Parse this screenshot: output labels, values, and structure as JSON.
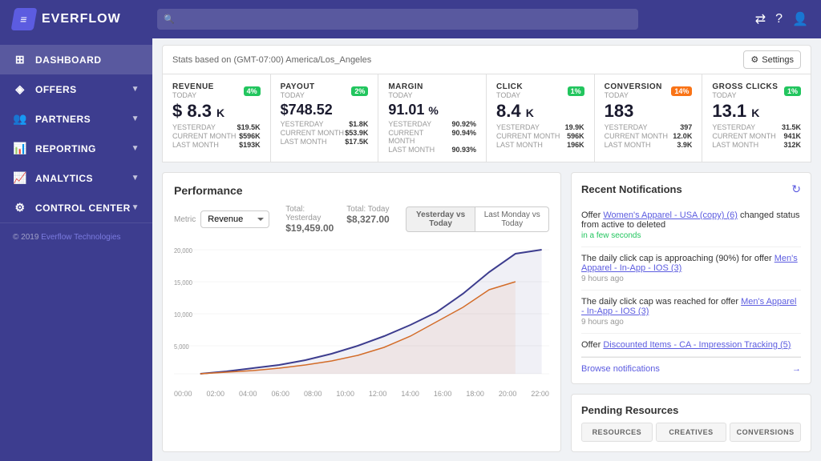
{
  "topnav": {
    "logo_text": "EVERFLOW",
    "search_placeholder": "",
    "icons": [
      "swap-icon",
      "help-icon",
      "user-icon"
    ]
  },
  "sidebar": {
    "items": [
      {
        "id": "dashboard",
        "label": "DASHBOARD",
        "icon": "⊞",
        "has_chevron": false,
        "active": true
      },
      {
        "id": "offers",
        "label": "OFFERS",
        "icon": "◈",
        "has_chevron": true
      },
      {
        "id": "partners",
        "label": "PARTNERS",
        "icon": "👥",
        "has_chevron": true
      },
      {
        "id": "reporting",
        "label": "REPORTING",
        "icon": "📊",
        "has_chevron": true
      },
      {
        "id": "analytics",
        "label": "ANALYTICS",
        "icon": "📈",
        "has_chevron": true
      },
      {
        "id": "control_center",
        "label": "CONTROL CENTER",
        "icon": "⚙",
        "has_chevron": true
      }
    ],
    "footer_text": "© 2019",
    "footer_link_text": "Everflow Technologies",
    "footer_link_url": "#"
  },
  "stats_header": {
    "timezone_label": "Stats based on (GMT-07:00) America/Los_Angeles",
    "settings_label": "Settings"
  },
  "stat_cards": [
    {
      "id": "revenue",
      "label": "REVENUE",
      "sublabel": "TODAY",
      "badge": "4%",
      "badge_color": "green",
      "value": "$ 8.3 K",
      "rows": [
        {
          "label": "YESTERDAY",
          "val": "$19.5K"
        },
        {
          "label": "CURRENT MONTH",
          "val": "$596K"
        },
        {
          "label": "LAST MONTH",
          "val": "$193K"
        }
      ]
    },
    {
      "id": "payout",
      "label": "PAYOUT",
      "sublabel": "TODAY",
      "badge": "2%",
      "badge_color": "green",
      "value": "$748.52",
      "rows": [
        {
          "label": "YESTERDAY",
          "val": "$1.8K"
        },
        {
          "label": "CURRENT MONTH",
          "val": "$53.9K"
        },
        {
          "label": "LAST MONTH",
          "val": "$17.5K"
        }
      ]
    },
    {
      "id": "margin",
      "label": "MARGIN",
      "sublabel": "TODAY",
      "badge": null,
      "value": "91.01 %",
      "rows": [
        {
          "label": "YESTERDAY",
          "val": "90.92%"
        },
        {
          "label": "CURRENT MONTH",
          "val": "90.94%"
        },
        {
          "label": "LAST MONTH",
          "val": "90.93%"
        }
      ]
    },
    {
      "id": "click",
      "label": "CLICK",
      "sublabel": "TODAY",
      "badge": "1%",
      "badge_color": "green",
      "value": "8.4 K",
      "rows": [
        {
          "label": "YESTERDAY",
          "val": "19.9K"
        },
        {
          "label": "CURRENT MONTH",
          "val": "596K"
        },
        {
          "label": "LAST MONTH",
          "val": "196K"
        }
      ]
    },
    {
      "id": "conversion",
      "label": "CONVERSION",
      "sublabel": "TODAY",
      "badge": "14%",
      "badge_color": "orange",
      "value": "183",
      "rows": [
        {
          "label": "YESTERDAY",
          "val": "397"
        },
        {
          "label": "CURRENT MONTH",
          "val": "12.0K"
        },
        {
          "label": "LAST MONTH",
          "val": "3.9K"
        }
      ]
    },
    {
      "id": "gross_clicks",
      "label": "GROSS CLICKS",
      "sublabel": "TODAY",
      "badge": "1%",
      "badge_color": "green",
      "value": "13.1 K",
      "rows": [
        {
          "label": "YESTERDAY",
          "val": "31.5K"
        },
        {
          "label": "CURRENT MONTH",
          "val": "941K"
        },
        {
          "label": "LAST MONTH",
          "val": "312K"
        }
      ]
    }
  ],
  "performance": {
    "title": "Performance",
    "metric_label": "Metric",
    "metric_value": "Revenue",
    "total_yesterday_label": "Total: Yesterday",
    "total_yesterday_value": "$19,459.00",
    "total_today_label": "Total: Today",
    "total_today_value": "$8,327.00",
    "btn_yesterday": "Yesterday vs Today",
    "btn_last_monday": "Last Monday vs Today",
    "chart_y_labels": [
      "20,000",
      "15,000",
      "10,000",
      "5,000"
    ],
    "chart_x_labels": [
      "00:00",
      "02:00",
      "04:00",
      "06:00",
      "08:00",
      "10:00",
      "12:00",
      "14:00",
      "16:00",
      "18:00",
      "20:00",
      "22:00"
    ]
  },
  "notifications": {
    "title": "Recent Notifications",
    "refresh_icon": "↻",
    "items": [
      {
        "text_before": "Offer ",
        "link": "Women's Apparel - USA (copy) (6)",
        "text_after": " changed status from active to deleted",
        "time": "in a few seconds",
        "time_color": "green"
      },
      {
        "text_before": "The daily click cap is approaching (90%) for offer ",
        "link": "Men's Apparel - In-App - IOS (3)",
        "text_after": "",
        "time": "9 hours ago",
        "time_color": "gray"
      },
      {
        "text_before": "The daily click cap was reached for offer ",
        "link": "Men's Apparel - In-App - IOS (3)",
        "text_after": "",
        "time": "9 hours ago",
        "time_color": "gray"
      },
      {
        "text_before": "Offer ",
        "link": "Discounted Items - CA - Impression Tracking (5)",
        "text_after": "",
        "time": "",
        "time_color": "gray"
      }
    ],
    "browse_label": "Browse notifications"
  },
  "pending_resources": {
    "title": "Pending Resources",
    "items": [
      "RESOURCES",
      "CREATIVES",
      "CONVERSIONS"
    ]
  }
}
